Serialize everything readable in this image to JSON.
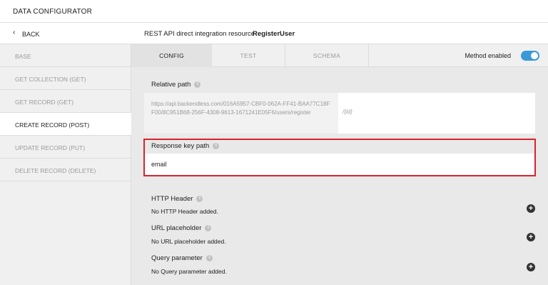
{
  "app": {
    "title": "DATA CONFIGURATOR"
  },
  "sidebar": {
    "back_label": "BACK",
    "items": [
      {
        "label": "BASE"
      },
      {
        "label": "GET COLLECTION (GET)"
      },
      {
        "label": "GET RECORD (GET)"
      },
      {
        "label": "CREATE RECORD (POST)"
      },
      {
        "label": "UPDATE RECORD (PUT)"
      },
      {
        "label": "DELETE RECORD (DELETE)"
      }
    ],
    "active_index": 3
  },
  "header": {
    "prefix": "REST API direct integration resource",
    "resource_name": "RegisterUser"
  },
  "tabs": [
    {
      "label": "CONFIG"
    },
    {
      "label": "TEST"
    },
    {
      "label": "SCHEMA"
    }
  ],
  "active_tab": 0,
  "method_enabled": {
    "label": "Method enabled",
    "value": true
  },
  "relative_path": {
    "label": "Relative path",
    "base_url": "https://api.backendless.com/016A5957-CBF0-062A-FF41-BAA77C18FF00/8C951B68-256F-4308-9613-1671241E05F6/users/register",
    "suffix_placeholder": "/{id}"
  },
  "response_key_path": {
    "label": "Response key path",
    "value": "email"
  },
  "sections": [
    {
      "title": "HTTP Header",
      "empty_text": "No HTTP Header added."
    },
    {
      "title": "URL placeholder",
      "empty_text": "No URL placeholder added."
    },
    {
      "title": "Query parameter",
      "empty_text": "No Query parameter added."
    }
  ],
  "colors": {
    "accent": "#3a99d8",
    "highlight": "#d9232d"
  }
}
